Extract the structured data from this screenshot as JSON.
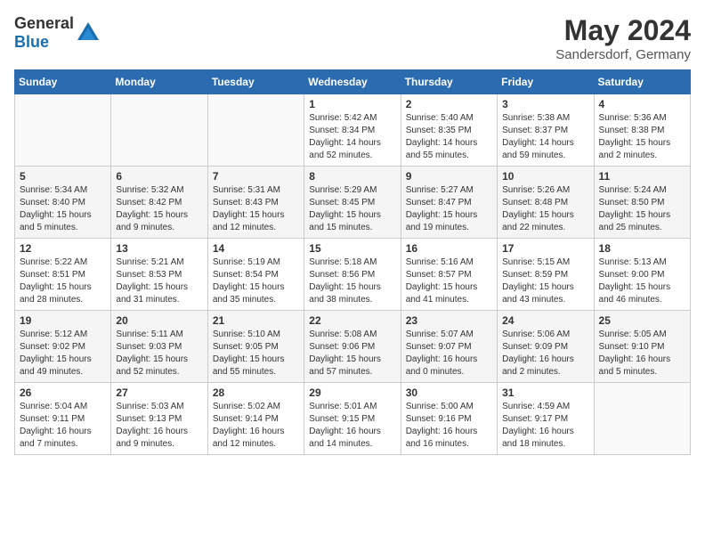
{
  "header": {
    "logo_general": "General",
    "logo_blue": "Blue",
    "title": "May 2024",
    "location": "Sandersdorf, Germany"
  },
  "weekdays": [
    "Sunday",
    "Monday",
    "Tuesday",
    "Wednesday",
    "Thursday",
    "Friday",
    "Saturday"
  ],
  "weeks": [
    [
      {
        "day": "",
        "info": ""
      },
      {
        "day": "",
        "info": ""
      },
      {
        "day": "",
        "info": ""
      },
      {
        "day": "1",
        "info": "Sunrise: 5:42 AM\nSunset: 8:34 PM\nDaylight: 14 hours\nand 52 minutes."
      },
      {
        "day": "2",
        "info": "Sunrise: 5:40 AM\nSunset: 8:35 PM\nDaylight: 14 hours\nand 55 minutes."
      },
      {
        "day": "3",
        "info": "Sunrise: 5:38 AM\nSunset: 8:37 PM\nDaylight: 14 hours\nand 59 minutes."
      },
      {
        "day": "4",
        "info": "Sunrise: 5:36 AM\nSunset: 8:38 PM\nDaylight: 15 hours\nand 2 minutes."
      }
    ],
    [
      {
        "day": "5",
        "info": "Sunrise: 5:34 AM\nSunset: 8:40 PM\nDaylight: 15 hours\nand 5 minutes."
      },
      {
        "day": "6",
        "info": "Sunrise: 5:32 AM\nSunset: 8:42 PM\nDaylight: 15 hours\nand 9 minutes."
      },
      {
        "day": "7",
        "info": "Sunrise: 5:31 AM\nSunset: 8:43 PM\nDaylight: 15 hours\nand 12 minutes."
      },
      {
        "day": "8",
        "info": "Sunrise: 5:29 AM\nSunset: 8:45 PM\nDaylight: 15 hours\nand 15 minutes."
      },
      {
        "day": "9",
        "info": "Sunrise: 5:27 AM\nSunset: 8:47 PM\nDaylight: 15 hours\nand 19 minutes."
      },
      {
        "day": "10",
        "info": "Sunrise: 5:26 AM\nSunset: 8:48 PM\nDaylight: 15 hours\nand 22 minutes."
      },
      {
        "day": "11",
        "info": "Sunrise: 5:24 AM\nSunset: 8:50 PM\nDaylight: 15 hours\nand 25 minutes."
      }
    ],
    [
      {
        "day": "12",
        "info": "Sunrise: 5:22 AM\nSunset: 8:51 PM\nDaylight: 15 hours\nand 28 minutes."
      },
      {
        "day": "13",
        "info": "Sunrise: 5:21 AM\nSunset: 8:53 PM\nDaylight: 15 hours\nand 31 minutes."
      },
      {
        "day": "14",
        "info": "Sunrise: 5:19 AM\nSunset: 8:54 PM\nDaylight: 15 hours\nand 35 minutes."
      },
      {
        "day": "15",
        "info": "Sunrise: 5:18 AM\nSunset: 8:56 PM\nDaylight: 15 hours\nand 38 minutes."
      },
      {
        "day": "16",
        "info": "Sunrise: 5:16 AM\nSunset: 8:57 PM\nDaylight: 15 hours\nand 41 minutes."
      },
      {
        "day": "17",
        "info": "Sunrise: 5:15 AM\nSunset: 8:59 PM\nDaylight: 15 hours\nand 43 minutes."
      },
      {
        "day": "18",
        "info": "Sunrise: 5:13 AM\nSunset: 9:00 PM\nDaylight: 15 hours\nand 46 minutes."
      }
    ],
    [
      {
        "day": "19",
        "info": "Sunrise: 5:12 AM\nSunset: 9:02 PM\nDaylight: 15 hours\nand 49 minutes."
      },
      {
        "day": "20",
        "info": "Sunrise: 5:11 AM\nSunset: 9:03 PM\nDaylight: 15 hours\nand 52 minutes."
      },
      {
        "day": "21",
        "info": "Sunrise: 5:10 AM\nSunset: 9:05 PM\nDaylight: 15 hours\nand 55 minutes."
      },
      {
        "day": "22",
        "info": "Sunrise: 5:08 AM\nSunset: 9:06 PM\nDaylight: 15 hours\nand 57 minutes."
      },
      {
        "day": "23",
        "info": "Sunrise: 5:07 AM\nSunset: 9:07 PM\nDaylight: 16 hours\nand 0 minutes."
      },
      {
        "day": "24",
        "info": "Sunrise: 5:06 AM\nSunset: 9:09 PM\nDaylight: 16 hours\nand 2 minutes."
      },
      {
        "day": "25",
        "info": "Sunrise: 5:05 AM\nSunset: 9:10 PM\nDaylight: 16 hours\nand 5 minutes."
      }
    ],
    [
      {
        "day": "26",
        "info": "Sunrise: 5:04 AM\nSunset: 9:11 PM\nDaylight: 16 hours\nand 7 minutes."
      },
      {
        "day": "27",
        "info": "Sunrise: 5:03 AM\nSunset: 9:13 PM\nDaylight: 16 hours\nand 9 minutes."
      },
      {
        "day": "28",
        "info": "Sunrise: 5:02 AM\nSunset: 9:14 PM\nDaylight: 16 hours\nand 12 minutes."
      },
      {
        "day": "29",
        "info": "Sunrise: 5:01 AM\nSunset: 9:15 PM\nDaylight: 16 hours\nand 14 minutes."
      },
      {
        "day": "30",
        "info": "Sunrise: 5:00 AM\nSunset: 9:16 PM\nDaylight: 16 hours\nand 16 minutes."
      },
      {
        "day": "31",
        "info": "Sunrise: 4:59 AM\nSunset: 9:17 PM\nDaylight: 16 hours\nand 18 minutes."
      },
      {
        "day": "",
        "info": ""
      }
    ]
  ]
}
